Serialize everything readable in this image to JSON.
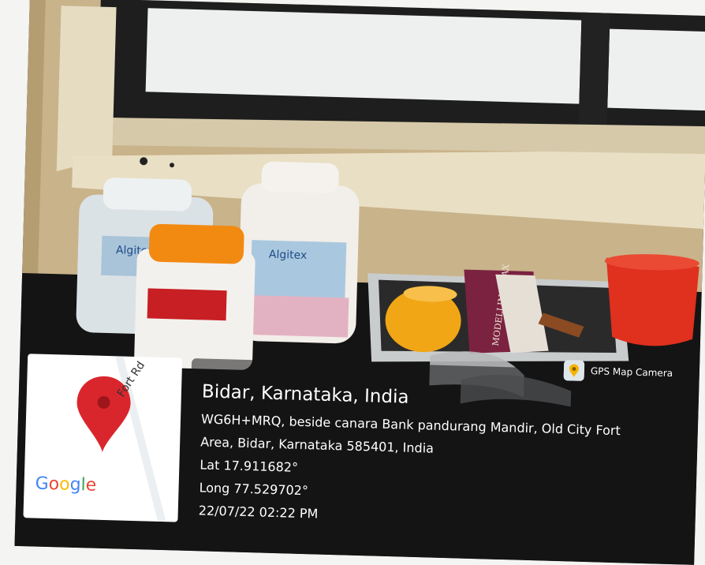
{
  "geotag": {
    "app_name": "GPS Map Camera",
    "app_icon": "map-pin-app-icon",
    "title": "Bidar, Karnataka, India",
    "address_line_1": "WG6H+MRQ, beside canara Bank pandurang Mandir, Old City Fort",
    "address_line_2": "Area, Bidar, Karnataka 585401, India",
    "latitude": "Lat 17.911682°",
    "longitude": "Long 77.529702°",
    "datetime": "22/07/22 02:22 PM"
  },
  "map_thumbnail": {
    "road_label": "Fort Rd",
    "pin_icon": "location-pin-icon",
    "pin_color": "#d9262c",
    "google_logo": {
      "letters": [
        "G",
        "o",
        "o",
        "g",
        "l",
        "e"
      ],
      "colors": [
        "#4285f4",
        "#ea4335",
        "#fbbc05",
        "#4285f4",
        "#34a853",
        "#ea4335"
      ]
    }
  },
  "products": {
    "container_1_label": "Algitex",
    "container_2_label": "Algitex",
    "tray_box_label": "MODELLING WAX"
  },
  "colors": {
    "wall": "#c9b38a",
    "sill": "#e6dcc2",
    "counter": "#141414",
    "orange_lid": "#f28a12",
    "red_bowl": "#e0301e",
    "yellow_bowl": "#f1a616"
  }
}
